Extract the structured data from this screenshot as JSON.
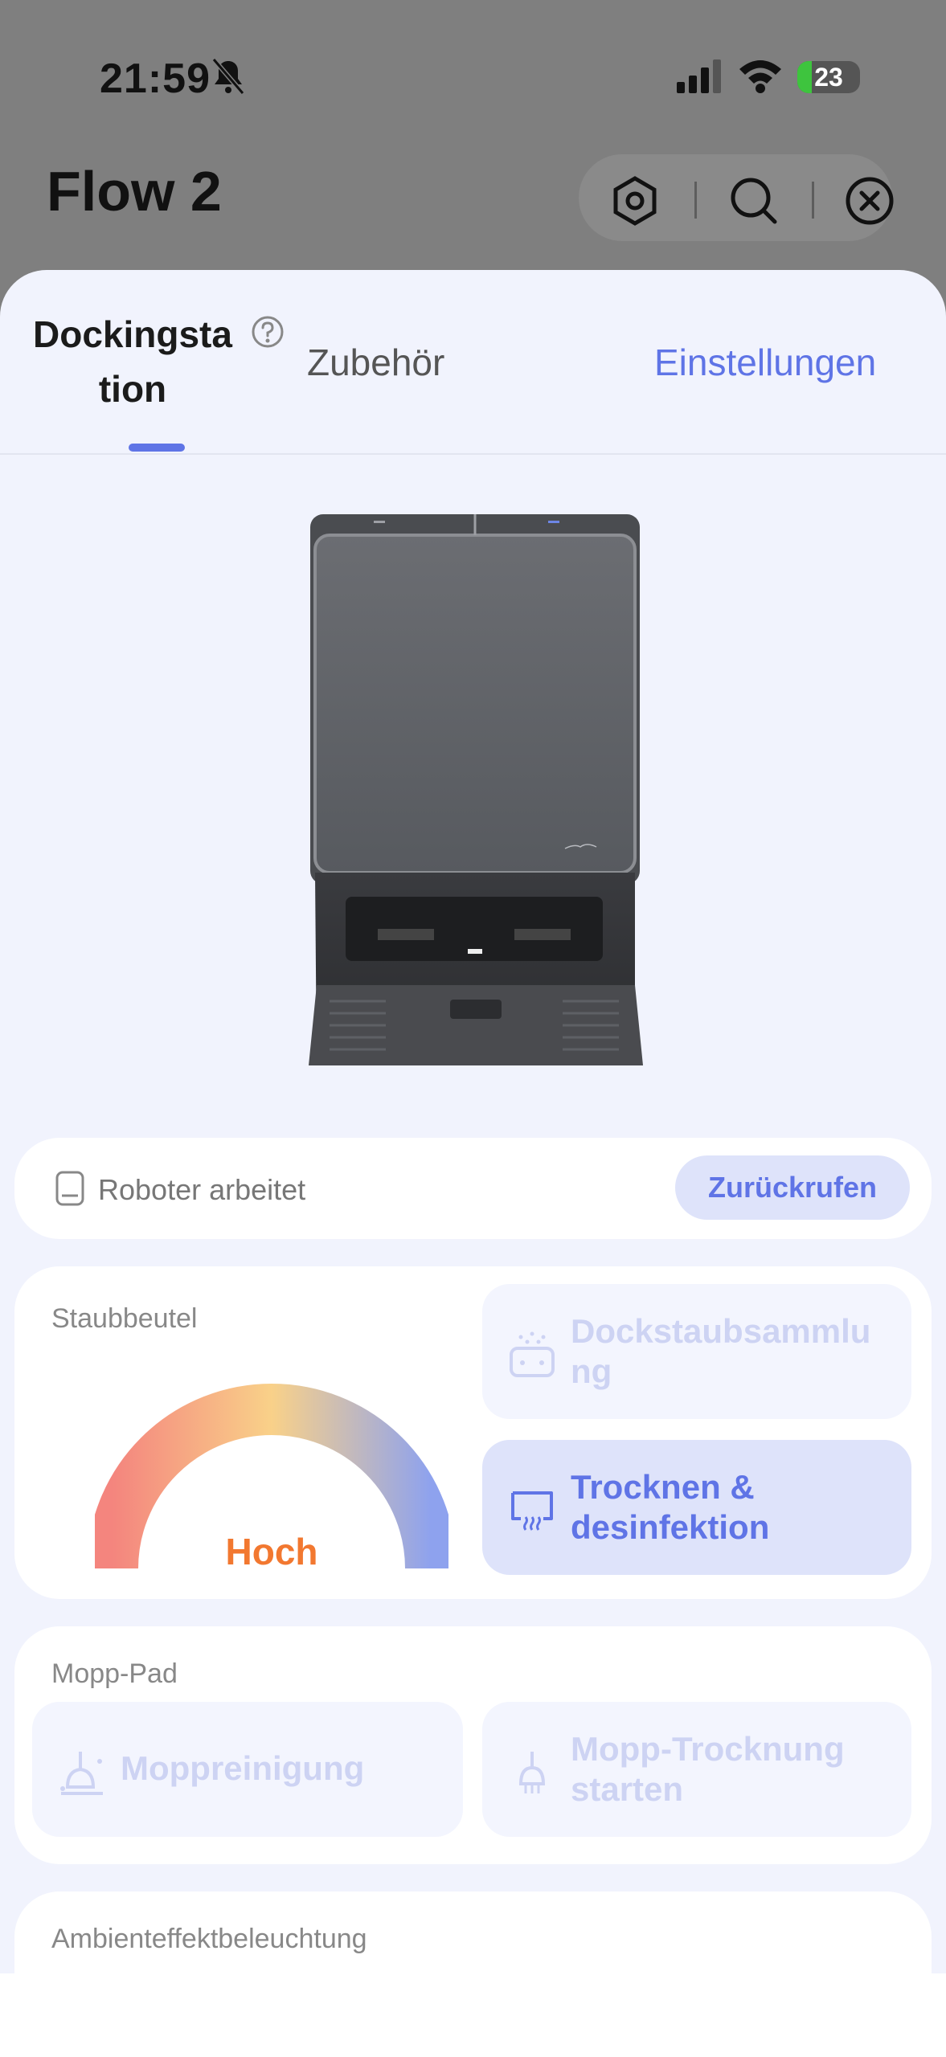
{
  "status_bar": {
    "time": "21:59",
    "battery": "23",
    "battery_level": 0.23
  },
  "header": {
    "title": "Flow 2"
  },
  "tabs": {
    "dock": "Dockingsta tion",
    "accessories": "Zubehör",
    "settings": "Einstellungen"
  },
  "robot_status": {
    "text": "Roboter arbeitet",
    "recall_label": "Zurückrufen"
  },
  "dust_bag": {
    "label": "Staubbeutel",
    "level": "Hoch",
    "dock_dust_collection": "Dockstaubsammlu ng",
    "dry_disinfect": "Trocknen & desinfektion"
  },
  "mop_pad": {
    "label": "Mopp-Pad",
    "mop_cleaning": "Moppreinigung",
    "start_mop_drying": "Mopp-Trocknung starten"
  },
  "ambient": {
    "label": "Ambienteffektbeleuchtung"
  },
  "colors": {
    "accent": "#5f74e6",
    "level_high": "#f27830"
  }
}
